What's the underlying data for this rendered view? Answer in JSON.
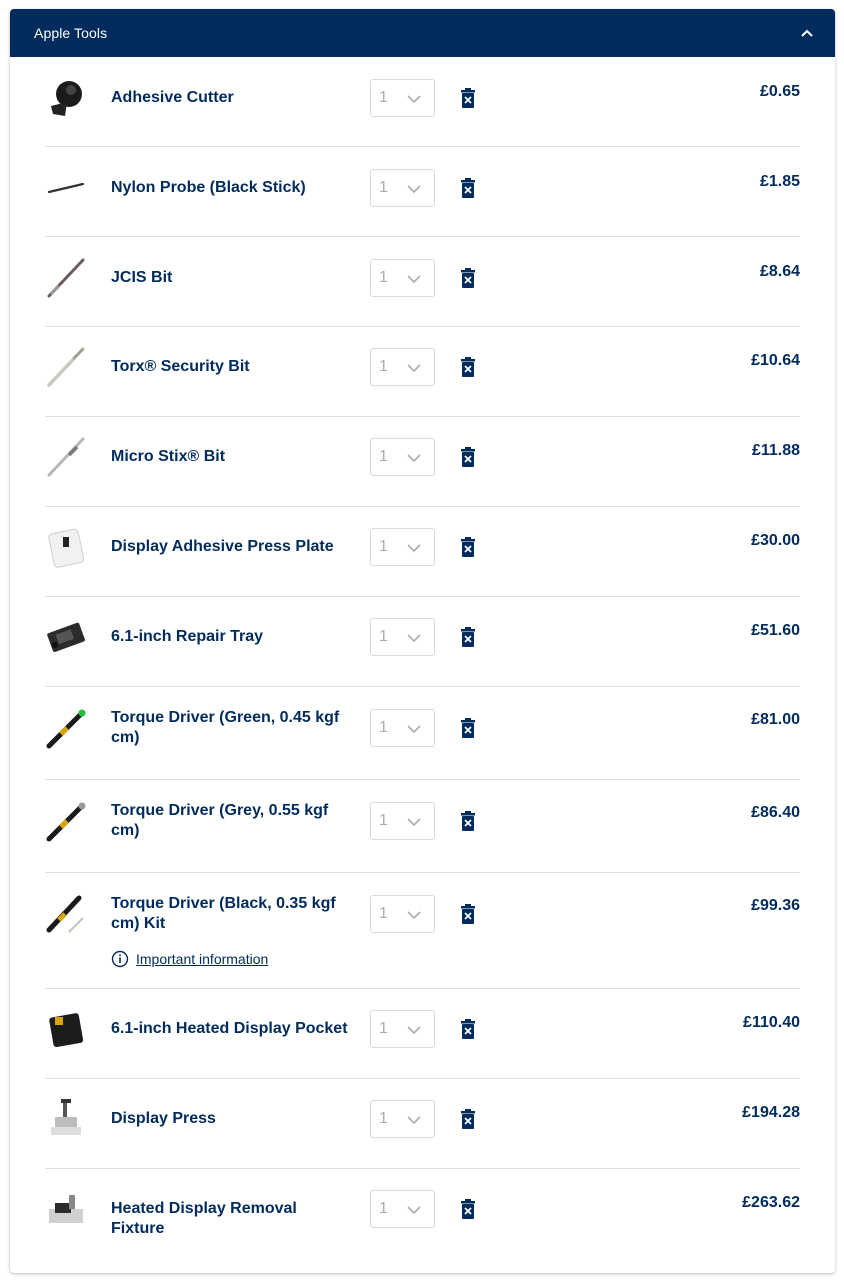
{
  "panel": {
    "title": "Apple Tools",
    "collapse_icon": "chevron-up-icon"
  },
  "colors": {
    "header_bg": "#002b5c",
    "text_primary": "#002b5c",
    "divider": "#dcdfe3"
  },
  "items": [
    {
      "name": "Adhesive Cutter",
      "qty": "1",
      "price": "£0.65",
      "thumb": "adhesive-cutter"
    },
    {
      "name": "Nylon Probe (Black Stick)",
      "qty": "1",
      "price": "£1.85",
      "thumb": "nylon-probe"
    },
    {
      "name": "JCIS Bit",
      "qty": "1",
      "price": "£8.64",
      "thumb": "jcis-bit"
    },
    {
      "name": "Torx® Security Bit",
      "qty": "1",
      "price": "£10.64",
      "thumb": "torx-bit"
    },
    {
      "name": "Micro Stix® Bit",
      "qty": "1",
      "price": "£11.88",
      "thumb": "micro-stix-bit"
    },
    {
      "name": "Display Adhesive Press Plate",
      "qty": "1",
      "price": "£30.00",
      "thumb": "press-plate"
    },
    {
      "name": "6.1-inch Repair Tray",
      "qty": "1",
      "price": "£51.60",
      "thumb": "repair-tray"
    },
    {
      "name": "Torque Driver (Green, 0.45 kgf cm)",
      "qty": "1",
      "price": "£81.00",
      "thumb": "torque-driver-green"
    },
    {
      "name": "Torque Driver (Grey, 0.55 kgf cm)",
      "qty": "1",
      "price": "£86.40",
      "thumb": "torque-driver-grey"
    },
    {
      "name": "Torque Driver (Black, 0.35 kgf cm) Kit",
      "qty": "1",
      "price": "£99.36",
      "thumb": "torque-driver-kit",
      "info": "Important information"
    },
    {
      "name": "6.1-inch Heated Display Pocket",
      "qty": "1",
      "price": "£110.40",
      "thumb": "heated-pocket"
    },
    {
      "name": "Display Press",
      "qty": "1",
      "price": "£194.28",
      "thumb": "display-press"
    },
    {
      "name": "Heated Display Removal Fixture",
      "qty": "1",
      "price": "£263.62",
      "thumb": "removal-fixture"
    }
  ]
}
